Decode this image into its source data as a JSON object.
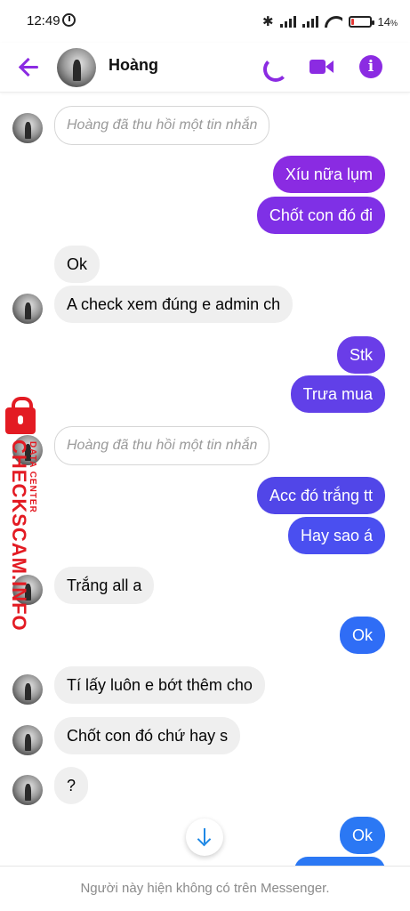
{
  "status_bar": {
    "time": "12:49",
    "battery_text": "14",
    "battery_unit": "%",
    "battery_level": 0.14
  },
  "header": {
    "contact_name": "Hoàng"
  },
  "chat": {
    "recalled_1": "Hoàng đã thu hồi một tin nhắn",
    "out_1": "Xíu nữa lụm",
    "out_2": "Chốt con đó đi",
    "in_1": "Ok",
    "in_2": "A check xem đúng e admin ch",
    "out_3": "Stk",
    "out_4": "Trưa mua",
    "recalled_2": "Hoàng đã thu hồi một tin nhắn",
    "out_5": "Acc đó trắng tt",
    "out_6": "Hay sao á",
    "in_3": "Trắng all a",
    "out_7": "Ok",
    "in_4": "Tí lấy luôn e bớt thêm cho",
    "in_5": "Chốt con đó chứ hay s",
    "in_6": "?",
    "out_8": "Ok"
  },
  "footer": {
    "notice": "Người này hiện không có trên Messenger."
  },
  "watermark": {
    "main": "CHECKSCAM.INFO",
    "sub": "DATA CENTER"
  },
  "colors": {
    "accent": "#8b2be2",
    "bubble_purple": "#8a2be2",
    "bubble_violet": "#6a3de8",
    "bubble_indigo": "#5146e8",
    "bubble_blue": "#2f6df6",
    "incoming": "#efefef",
    "watermark": "#e31b23"
  },
  "icons": [
    "back-arrow-icon",
    "phone-icon",
    "video-call-icon",
    "info-icon",
    "alarm-icon",
    "bluetooth-icon",
    "signal-icon",
    "wifi-icon",
    "battery-icon",
    "arrow-down-icon",
    "lock-icon"
  ]
}
